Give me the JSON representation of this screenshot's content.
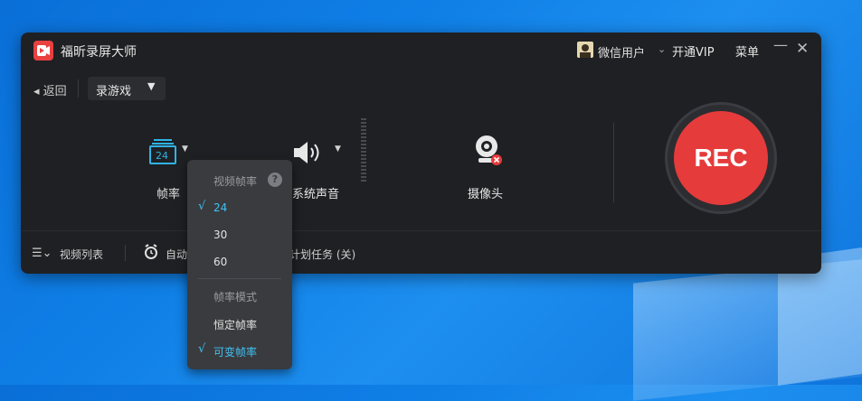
{
  "app": {
    "title": "福昕录屏大师"
  },
  "header": {
    "user_name": "微信用户",
    "vip_label": "开通VIP",
    "menu_label": "菜单",
    "minimize_glyph": "—",
    "close_glyph": "✕"
  },
  "toolbar": {
    "back_label": "返回",
    "back_glyph": "◂",
    "mode_value": "录游戏",
    "mode_arrow": "▼"
  },
  "controls": {
    "framerate": {
      "label": "帧率",
      "icon_value": "24",
      "icon": "framerate-icon"
    },
    "sound": {
      "label": "系统声音",
      "icon": "speaker-icon"
    },
    "camera": {
      "label": "摄像头",
      "icon": "webcam-icon"
    },
    "rec_label": "REC"
  },
  "bottom": {
    "list_label": "视频列表",
    "auto_label": "自动",
    "schedule_label": "计划任务 (关)"
  },
  "framerate_menu": {
    "header": "视频帧率",
    "help_glyph": "?",
    "options": [
      "24",
      "30",
      "60"
    ],
    "selected": "24",
    "mode_header": "帧率模式",
    "modes": [
      "恒定帧率",
      "可变帧率"
    ],
    "selected_mode": "可变帧率",
    "check_glyph": "√"
  },
  "colors": {
    "accent": "#3fc2f3",
    "record": "#e63b3b",
    "panel": "#1f2023",
    "desktop": "#0f7fe6"
  }
}
